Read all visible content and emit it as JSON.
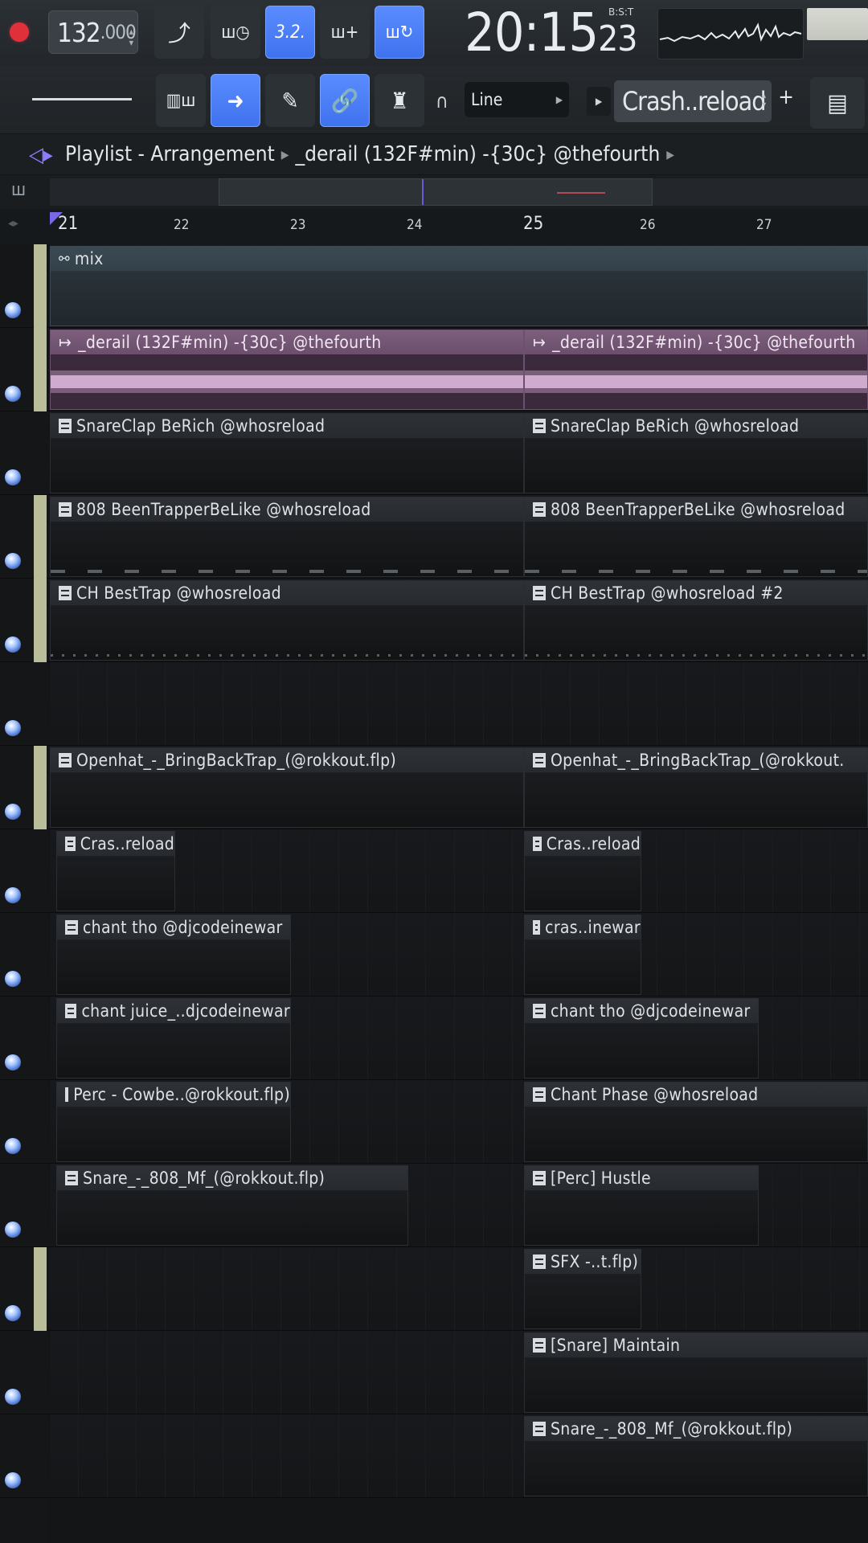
{
  "transport": {
    "tempo_main": "132",
    "tempo_frac": ".000",
    "time_main": "20:15",
    "time_sub": "23",
    "time_format": "B:S:T"
  },
  "toolbar": {
    "snap_label": "Line",
    "pattern_name": "Crash..reload",
    "add_label": "+"
  },
  "playlist": {
    "title": "Playlist - Arrangement",
    "arrangement": "_derail (132F#min)  -{30c}  @thefourth"
  },
  "ruler": [
    "21",
    "22",
    "23",
    "24",
    "25",
    "26",
    "27"
  ],
  "tracks": [
    {
      "clips": [
        {
          "label": "mix"
        }
      ]
    },
    {
      "clips": [
        {
          "label": "_derail (132F#min)  -{30c}  @thefourth"
        },
        {
          "label": "_derail (132F#min)  -{30c}  @thefourth"
        }
      ]
    },
    {
      "clips": [
        {
          "label": "SnareClap BeRich @whosreload"
        },
        {
          "label": "SnareClap BeRich @whosreload"
        }
      ]
    },
    {
      "clips": [
        {
          "label": "808 BeenTrapperBeLike @whosreload"
        },
        {
          "label": "808 BeenTrapperBeLike @whosreload"
        }
      ]
    },
    {
      "clips": [
        {
          "label": "CH BestTrap @whosreload"
        },
        {
          "label": "CH BestTrap @whosreload #2"
        }
      ]
    },
    {
      "clips": []
    },
    {
      "clips": [
        {
          "label": "Openhat_-_BringBackTrap_(@rokkout.flp)"
        },
        {
          "label": "Openhat_-_BringBackTrap_(@rokkout."
        }
      ]
    },
    {
      "clips": [
        {
          "label": "Cras..reload"
        },
        {
          "label": "Cras..reload"
        }
      ]
    },
    {
      "clips": [
        {
          "label": "chant tho @djcodeinewar"
        },
        {
          "label": "cras..inewar"
        }
      ]
    },
    {
      "clips": [
        {
          "label": "chant juice_..djcodeinewar"
        },
        {
          "label": "chant tho @djcodeinewar"
        }
      ]
    },
    {
      "clips": [
        {
          "label": "Perc - Cowbe..@rokkout.flp)"
        },
        {
          "label": "Chant Phase @whosreload"
        }
      ]
    },
    {
      "clips": [
        {
          "label": "Snare_-_808_Mf_(@rokkout.flp)"
        },
        {
          "label": "[Perc] Hustle"
        }
      ]
    },
    {
      "clips": [
        {
          "label": "SFX -..t.flp)"
        }
      ]
    },
    {
      "clips": [
        {
          "label": "[Snare] Maintain"
        }
      ]
    },
    {
      "clips": [
        {
          "label": "Snare_-_808_Mf_(@rokkout.flp)"
        }
      ]
    }
  ]
}
